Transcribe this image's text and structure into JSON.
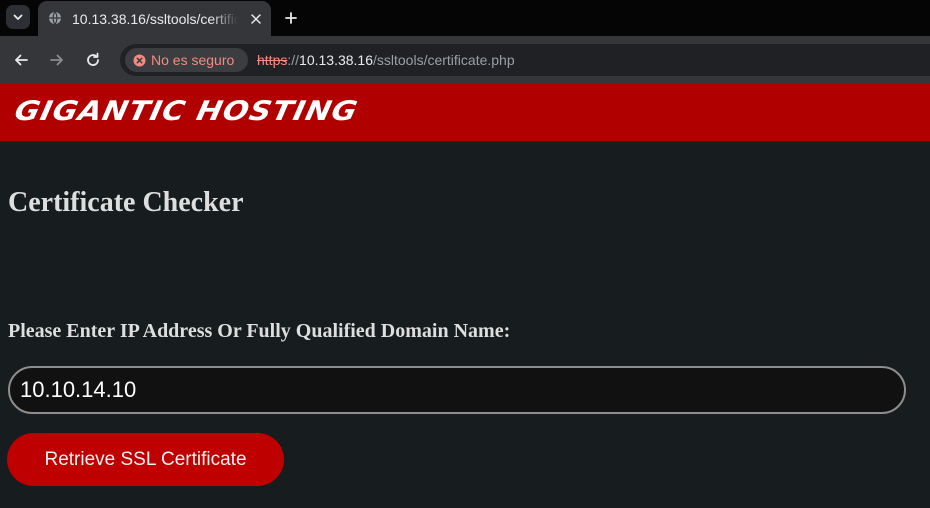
{
  "browser": {
    "tab": {
      "title": "10.13.38.16/ssltools/certificate.php"
    },
    "security_label": "No es seguro",
    "url": {
      "scheme": "https",
      "separator": "://",
      "host": "10.13.38.16",
      "path": "/ssltools/certificate.php"
    },
    "icons": {
      "tab_list": "chevron-down-icon",
      "favicon": "globe-icon",
      "tab_close": "close-icon",
      "new_tab": "plus-icon",
      "back": "arrow-left-icon",
      "forward": "arrow-right-icon",
      "reload": "reload-icon",
      "security": "warning-icon"
    }
  },
  "page": {
    "brand": "GIGANTIC HOSTING",
    "title": "Certificate Checker",
    "field_label": "Please Enter IP Address Or Fully Qualified Domain Name:",
    "input_value": "10.10.14.10",
    "submit_label": "Retrieve SSL Certificate"
  },
  "colors": {
    "banner": "#b00000",
    "background": "#171c1e",
    "button": "#be0000",
    "security_text": "#f28b82"
  }
}
